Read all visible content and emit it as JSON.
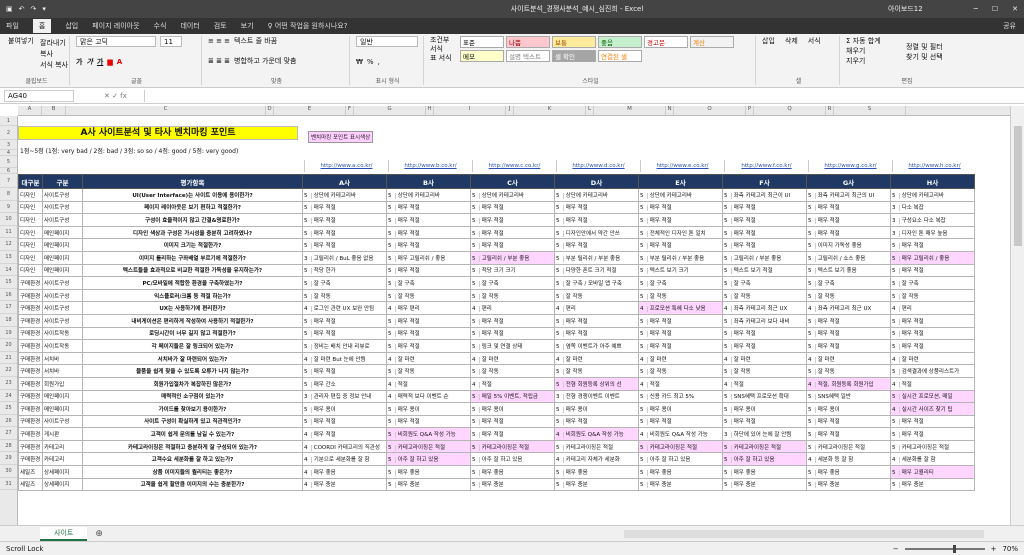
{
  "window": {
    "title": "사이트분석_경쟁사분석_예시_심진희  -  Excel",
    "user": "아이보드12",
    "min": "─",
    "max": "☐",
    "close": "✕"
  },
  "quick_access": {
    "save_icon": "save-icon",
    "undo": "↶",
    "redo": "↷",
    "more": "▾"
  },
  "menu": {
    "items": [
      "파일",
      "홈",
      "삽입",
      "페이지 레이아웃",
      "수식",
      "데이터",
      "검토",
      "보기"
    ],
    "tell": "♀ 어떤 작업을 원하시나요?",
    "share": "공유"
  },
  "ribbon": {
    "clipboard": {
      "paste": "붙여넣기",
      "cut": "잘라내기",
      "copy": "복사",
      "format": "서식 복사",
      "label": "클립보드"
    },
    "font": {
      "name": "맑은 고딕",
      "size": "11",
      "bold": "가",
      "italic": "가",
      "underline": "가",
      "label": "글꼴"
    },
    "align": {
      "wrap": "텍스트 줄 바꿈",
      "merge": "병합하고 가운데 맞춤",
      "label": "맞춤"
    },
    "number": {
      "format": "일반",
      "pct": "%",
      "comma": ",",
      "label": "표시 형식"
    },
    "cond": {
      "cond_format": "조건부 서식",
      "table_format": "표 서식",
      "label": "스타일"
    },
    "styles": [
      "표준",
      "나쁨",
      "보통",
      "좋음",
      "경고문",
      "계산",
      "메모",
      "설명 텍스트",
      "셀 확인",
      "연결된 셀"
    ],
    "cells": {
      "insert": "삽입",
      "delete": "삭제",
      "format": "서식",
      "label": "셀"
    },
    "edit": {
      "autosum": "Σ 자동 합계",
      "fill": "채우기",
      "clear": "지우기",
      "sort": "정렬 및 필터",
      "find": "찾기 및 선택",
      "label": "편집"
    }
  },
  "formula_bar": {
    "name_box": "AG40",
    "fx": "✕  ✓  fx",
    "value": ""
  },
  "sheet": {
    "banner": "A사 사이트분석 및 타사 벤치마킹 포인트",
    "legend": "벤치마킹 포인트 표시색상",
    "scale": "1점~5점 (1점: very bad / 2점: bad / 3점: so so / 4점: good / 5점: very good)",
    "urls": [
      "http://www.a.co.kr/",
      "http://www.b.co.kr/",
      "http://www.c.co.kr/",
      "http://www.d.co.kr/",
      "http://www.e.co.kr/",
      "http://www.f.co.kr/",
      "http://www.g.co.kr/",
      "http://www.h.co.kr/"
    ],
    "headers": [
      "대구분",
      "구분",
      "평가항목",
      "A사",
      "B사",
      "C사",
      "D사",
      "E사",
      "F사",
      "G사",
      "H사"
    ],
    "rows": [
      {
        "cat": "디자인",
        "sub": "사이트구성",
        "item": "UI(User Interface)는 사이트 이용에 용이한가?",
        "vals": [
          "5",
          "상단에 카테고리바",
          "5",
          "상단에 카테고리바",
          "5",
          "상단에 카테고리바",
          "5",
          "상단에 카테고리바",
          "5",
          "상단에 카테고리바",
          "5",
          "좌측 카테고리 최근이 UI",
          "5",
          "좌측 카테고리 최근의 UI",
          "5",
          "상단에 카테고리바"
        ],
        "pk": []
      },
      {
        "cat": "디자인",
        "sub": "사이트구성",
        "item": "페이지 레이아웃은 보기 편하고 적절한가?",
        "vals": [
          "5",
          "매우 적절",
          "5",
          "매우 적절",
          "5",
          "매우 적절",
          "5",
          "매우 적절",
          "5",
          "매우 적절",
          "5",
          "매우 적절",
          "5",
          "매우 적절",
          "3",
          "다소 복잡"
        ],
        "pk": []
      },
      {
        "cat": "디자인",
        "sub": "사이트구성",
        "item": "구성이 효율적이지 않고 간결&명료한가?",
        "vals": [
          "5",
          "매우 적절",
          "5",
          "매우 적절",
          "5",
          "매우 적절",
          "5",
          "매우 적절",
          "5",
          "매우 적절",
          "5",
          "매우 적절",
          "5",
          "매우 적절",
          "3",
          "구성요소 다소 복잡"
        ],
        "pk": []
      },
      {
        "cat": "디자인",
        "sub": "메인페이지",
        "item": "디자인 색상과 구성은 가시성을 충분히 고려하였나?",
        "vals": [
          "5",
          "매우 적절",
          "5",
          "매우 적절",
          "5",
          "매우 적절",
          "5",
          "디자인안에서 약간 안쓰",
          "5",
          "전체적인 디자인 톤 일치",
          "5",
          "매우 적절",
          "5",
          "매우 적절",
          "3",
          "디자인 톤 매우 높음"
        ],
        "pk": []
      },
      {
        "cat": "디자인",
        "sub": "메인페이지",
        "item": "이미지 크기는 적절한가?",
        "vals": [
          "5",
          "매우 적절",
          "5",
          "매우 적절",
          "5",
          "매우 적절",
          "5",
          "매우 적절",
          "5",
          "매우 적절",
          "5",
          "매우 적절",
          "5",
          "이미지 가독성 좋음",
          "5",
          "매우 적절"
        ],
        "pk": []
      },
      {
        "cat": "디자인",
        "sub": "메인페이지",
        "item": "이미지 롤리하는 구좌배열 부르기에 적절한가?",
        "vals": [
          "3",
          "고릴리쉬 / BuL 좋음 없음",
          "5",
          "매우 고릴리쉬 / 좋음",
          "5",
          "고릴리쉬 / 부분 좋음",
          "5",
          "부분 릴리쉬 / 부분 좋음",
          "5",
          "부분 릴리쉬 / 부분 좋음",
          "5",
          "고릴리쉬 / 부분 좋음",
          "5",
          "고릴리쉬 / 쇼스 좋음",
          "5",
          "매우 고릴리쉬 / 좋음"
        ],
        "pk": [
          4,
          15
        ]
      },
      {
        "cat": "디자인",
        "sub": "메인페이지",
        "item": "텍스트들을 효과적으로 비교한 적절한 가독성을 유지하는가?",
        "vals": [
          "5",
          "적당 한가",
          "5",
          "매우 적절",
          "5",
          "적당 크기 크기",
          "5",
          "다양한 폰트 크기 적절",
          "5",
          "텍스트 보기 크기",
          "5",
          "텍스트 보기 적절",
          "5",
          "텍스트 보기 좋음",
          "5",
          "매우 적절"
        ],
        "pk": []
      },
      {
        "cat": "구매환경",
        "sub": "사이트구성",
        "item": "PC/모바일에 적합한 환경을 구축하였는가?",
        "vals": [
          "5",
          "잘 구축",
          "5",
          "잘 구축",
          "5",
          "잘 구축",
          "5",
          "잘 구축 / 모바일 앱 구축",
          "5",
          "잘 구축",
          "5",
          "잘 구축",
          "5",
          "잘 구축",
          "5",
          "잘 구축"
        ],
        "pk": []
      },
      {
        "cat": "구매환경",
        "sub": "사이트구성",
        "item": "익스플로러/크롬 등 적절 하는가?",
        "vals": [
          "5",
          "잘 작동",
          "5",
          "잘 작동",
          "5",
          "잘 작동",
          "5",
          "잘 작동",
          "5",
          "잘 작동",
          "5",
          "잘 작동",
          "5",
          "잘 작동",
          "5",
          "잘 작동"
        ],
        "pk": []
      },
      {
        "cat": "구매환경",
        "sub": "사이트구성",
        "item": "UX는 사용하기에 편리한가?",
        "vals": [
          "4",
          "로그인 관련 UX 보완 안됨",
          "4",
          "매우 편리",
          "4",
          "편리",
          "4",
          "편리",
          "4",
          "프로모션 특혜 다소 낮음",
          "4",
          "좌측 카테고리 최근 UX",
          "4",
          "좌측 카테고리 최근 UX",
          "4",
          "편리"
        ],
        "pk": [
          8
        ]
      },
      {
        "cat": "구매환경",
        "sub": "사이트구성",
        "item": "내비게이션은 편리하게 작성하여 사용하기 적절한가?",
        "vals": [
          "5",
          "매우 적절",
          "5",
          "매우 적절",
          "5",
          "매우 적절",
          "5",
          "매우 적절",
          "5",
          "매우 적절",
          "5",
          "좌측 카테고리 보다 내비",
          "5",
          "매우 적절",
          "5",
          "매우 적절"
        ],
        "pk": []
      },
      {
        "cat": "구매환경",
        "sub": "사이트작동",
        "item": "로딩시간이 너무 길지 않고 적절한가?",
        "vals": [
          "5",
          "매우 적절",
          "5",
          "매우 적절",
          "5",
          "매우 적절",
          "5",
          "매우 적절",
          "5",
          "매우 적절",
          "5",
          "매우 적절",
          "5",
          "매우 적절",
          "5",
          "매우 적절"
        ],
        "pk": []
      },
      {
        "cat": "구매환경",
        "sub": "사이트작동",
        "item": "각 페이지들은 잘 링크되어 있는가?",
        "vals": [
          "5",
          "정비는 배치 안내 리뷰로",
          "5",
          "매우 적절",
          "5",
          "링크 및 연결 상태",
          "5",
          "옆쪽 이벤트가 아주 예쁘",
          "5",
          "매우 적절",
          "5",
          "매우 적절",
          "5",
          "매우 적절",
          "5",
          "매우 적절"
        ],
        "pk": []
      },
      {
        "cat": "구매환경",
        "sub": "서치바",
        "item": "서치바가 잘 마련되어 있는가?",
        "vals": [
          "4",
          "잘 마련 But 눈에 안띔",
          "4",
          "잘 마련",
          "4",
          "잘 마련",
          "4",
          "잘 마련",
          "4",
          "잘 마련",
          "4",
          "잘 마련",
          "4",
          "잘 마련",
          "4",
          "잘 마련"
        ],
        "pk": []
      },
      {
        "cat": "구매환경",
        "sub": "서치바",
        "item": "물품을 쉽게 찾을 수 있도록 오류가 나지 않는가?",
        "vals": [
          "5",
          "매우 적절",
          "5",
          "잘 작동",
          "5",
          "잘 작동",
          "5",
          "잘 작동",
          "5",
          "잘 작동",
          "5",
          "잘 작동",
          "5",
          "잘 작동",
          "5",
          "검색결과에 상품리스트가"
        ],
        "pk": []
      },
      {
        "cat": "구매환경",
        "sub": "회원가입",
        "item": "회원가입절차가 복잡하진 않은가?",
        "vals": [
          "5",
          "매우 간소",
          "4",
          "적절",
          "4",
          "적절",
          "5",
          "전형 회원등록 상위의 선",
          "4",
          "적절",
          "4",
          "적절",
          "4",
          "적절, 회원등록 회원가입",
          "4",
          "적절"
        ],
        "pk": [
          6,
          12
        ]
      },
      {
        "cat": "구매환경",
        "sub": "메인페이지",
        "item": "매력적인 소구점이 있는가?",
        "vals": [
          "3",
          "관리자 편집 중 정보 안내",
          "4",
          "매력적 보다 이벤트 순",
          "5",
          "매일 5% 이벤트, 적립금",
          "3",
          "전형 경쟁이벤트 이벤트",
          "5",
          "신용 카드 최고 5%",
          "5",
          "SNS혜택 프로모션 확대",
          "5",
          "SNS혜택 일반",
          "5",
          "실시간 프로모션, 매일"
        ],
        "pk": [
          4,
          14
        ]
      },
      {
        "cat": "구매환경",
        "sub": "메인페이지",
        "item": "가이드를 찾아보기 용이한가?",
        "vals": [
          "5",
          "매우 용이",
          "5",
          "매우 용이",
          "5",
          "매우 용이",
          "5",
          "매우 용이",
          "5",
          "매우 용이",
          "5",
          "매우 용이",
          "5",
          "매우 용이",
          "4",
          "실시간 사이즈 찾기 팁"
        ],
        "pk": [
          14
        ]
      },
      {
        "cat": "구매환경",
        "sub": "사이트구성",
        "item": "사이트 구성이 확실하게 있고 직관적인가?",
        "vals": [
          "5",
          "매우 적절",
          "5",
          "매우 적절",
          "5",
          "매우 적절",
          "5",
          "매우 적절",
          "5",
          "매우 적절",
          "5",
          "매우 적절",
          "5",
          "매우 적절",
          "5",
          "매우 적절"
        ],
        "pk": []
      },
      {
        "cat": "구매환경",
        "sub": "게시판",
        "item": "고객이 쉽게 문의를 남길 수 있는가?",
        "vals": [
          "4",
          "매우 적절",
          "5",
          "비회원도 Q&A 작성 가능",
          "5",
          "매우 적절",
          "4",
          "비회원도 Q&A 작성 가능",
          "4",
          "비회원도 Q&A 작성 가능",
          "3",
          "하단에 있어 눈에 잘 안띔",
          "5",
          "매우 적절",
          "5",
          "매우 적절"
        ],
        "pk": [
          2,
          6
        ]
      },
      {
        "cat": "구매환경",
        "sub": "카테고리",
        "item": "카테고라이징은 적절하고 충분하게 잘 구성되어 있는가?",
        "vals": [
          "4",
          "COORDI 카테고리의 직관성",
          "5",
          "카테고라이징은 적절",
          "5",
          "카테고라이징은 적절",
          "5",
          "카테고라이징은 적절",
          "5",
          "카테고라이징은 적절",
          "5",
          "카테고라이징은 적절",
          "5",
          "카테고라이징은 적절",
          "5",
          "카테고라이징은 적절"
        ],
        "pk": [
          2,
          4,
          8,
          10
        ]
      },
      {
        "cat": "구매환경",
        "sub": "카테고리",
        "item": "고객수요 세분화를 잘 하고 있는가?",
        "vals": [
          "4",
          "기분으로 세분화를 잘 함",
          "5",
          "아주 잘 하고 있음",
          "5",
          "아주 잘 하고 있음",
          "4",
          "카테고리 자체가 세분화",
          "5",
          "아주 잘 하고 있음",
          "5",
          "아주 잘 하고 있음",
          "4",
          "세분화 등 잘 함",
          "4",
          "세분화를 잘 함"
        ],
        "pk": [
          2,
          10
        ]
      },
      {
        "cat": "세일즈",
        "sub": "상세페이지",
        "item": "상품 이미지들의 퀄리티는 좋은가?",
        "vals": [
          "4",
          "매우 좋음",
          "5",
          "매우 좋음",
          "5",
          "매우 좋음",
          "5",
          "매우 좋음",
          "5",
          "매우 좋음",
          "5",
          "매우 좋음",
          "5",
          "매우 좋음",
          "5",
          "매우 고퀄리티"
        ],
        "pk": [
          14
        ]
      },
      {
        "cat": "세일즈",
        "sub": "상세페이지",
        "item": "고객을 쉽게 할만큼 이미지의 수는 충분한가?",
        "vals": [
          "4",
          "매우 충분",
          "5",
          "매우 충분",
          "5",
          "매우 충분",
          "5",
          "매우 충분",
          "5",
          "매우 충분",
          "5",
          "매우 충분",
          "5",
          "매우 충분",
          "5",
          "매우 충분"
        ],
        "pk": []
      }
    ]
  },
  "sheet_tabs": {
    "active": "사이트",
    "add": "⊕"
  },
  "status": {
    "mode": "Scroll Lock",
    "zoom": "70%"
  }
}
